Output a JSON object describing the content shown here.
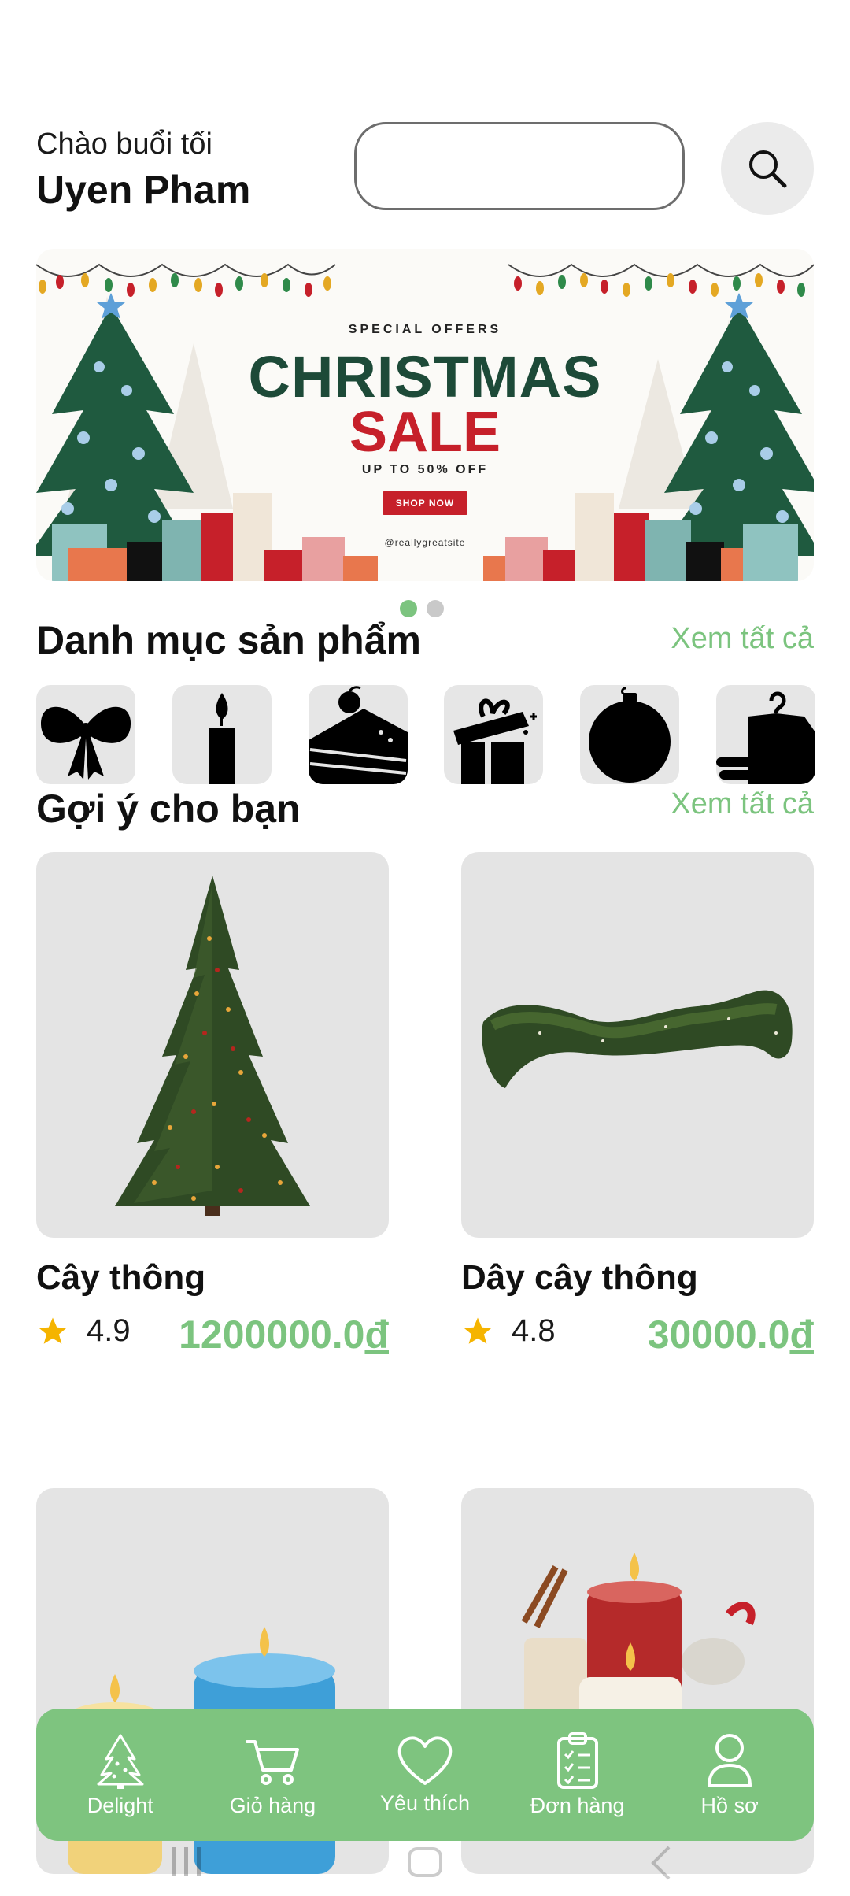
{
  "header": {
    "greeting": "Chào buổi tối",
    "username": "Uyen Pham",
    "search_placeholder": "",
    "search_icon": "search-icon"
  },
  "banner": {
    "special": "SPECIAL OFFERS",
    "title": "CHRISTMAS",
    "sale": "SALE",
    "discount": "UP TO 50% OFF",
    "cta": "SHOP NOW",
    "site": "@reallygreatsite",
    "slides_total": 2,
    "active_slide": 1
  },
  "categories": {
    "title": "Danh mục sản phẩm",
    "see_all": "Xem tất cả",
    "items": [
      {
        "icon": "bow-icon"
      },
      {
        "icon": "candle-icon"
      },
      {
        "icon": "cake-icon"
      },
      {
        "icon": "gift-box-icon"
      },
      {
        "icon": "ornament-ball-icon"
      },
      {
        "icon": "clothing-hanger-icon"
      }
    ]
  },
  "suggestions": {
    "title": "Gợi ý cho bạn",
    "see_all": "Xem tất cả",
    "products": [
      {
        "name": "Cây thông",
        "rating": "4.9",
        "price": "1200000.0",
        "currency": "đ",
        "image": "christmas-tree-image"
      },
      {
        "name": "Dây cây thông",
        "rating": "4.8",
        "price": "30000.0",
        "currency": "đ",
        "image": "pine-garland-image"
      },
      {
        "name": "",
        "rating": "",
        "price": "",
        "currency": "",
        "image": "candles-image"
      },
      {
        "name": "",
        "rating": "",
        "price": "",
        "currency": "",
        "image": "christmas-candles-image"
      }
    ]
  },
  "nav": {
    "items": [
      {
        "label": "Delight",
        "icon": "tree-icon"
      },
      {
        "label": "Giỏ hàng",
        "icon": "cart-icon"
      },
      {
        "label": "Yêu thích",
        "icon": "heart-icon"
      },
      {
        "label": "Đơn hàng",
        "icon": "clipboard-icon"
      },
      {
        "label": "Hồ sơ",
        "icon": "user-icon"
      }
    ]
  },
  "colors": {
    "accent": "#7cc47f",
    "nav_bg": "#7ec47f",
    "tile_bg": "#e4e4e4",
    "sale_red": "#c6202a",
    "christmas_green": "#1d4a38"
  }
}
